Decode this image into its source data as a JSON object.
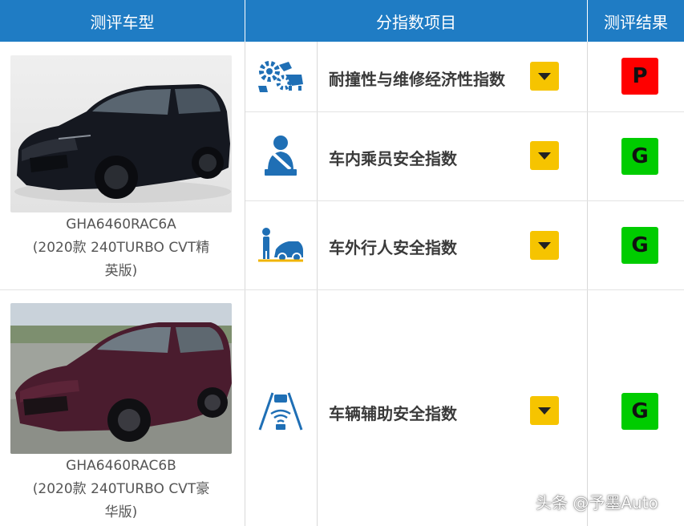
{
  "header": {
    "col_model": "测评车型",
    "col_items": "分指数项目",
    "col_result": "测评结果"
  },
  "colors": {
    "header_bg": "#1f7cc4",
    "dropdown": "#f6c400",
    "rating_poor": "#ff0000",
    "rating_good": "#00cc00",
    "icon_blue": "#1f6fb5"
  },
  "cars": [
    {
      "model_code": "GHA6460RAC6A",
      "variant_line1": "(2020款 240TURBO CVT精",
      "variant_line2": "英版)",
      "photo": "black-suv-photo"
    },
    {
      "model_code": "GHA6460RAC6B",
      "variant_line1": "(2020款 240TURBO CVT豪",
      "variant_line2": "华版)",
      "photo": "maroon-suv-photo"
    }
  ],
  "items": [
    {
      "icon": "crash-repair-icon",
      "label": "耐撞性与维修经济性指数",
      "rating": "P"
    },
    {
      "icon": "occupant-seatbelt-icon",
      "label": "车内乘员安全指数",
      "rating": "G"
    },
    {
      "icon": "pedestrian-car-icon",
      "label": "车外行人安全指数",
      "rating": "G"
    },
    {
      "icon": "driver-assist-icon",
      "label": "车辆辅助安全指数",
      "rating": "G"
    }
  ],
  "watermark": "头条 @予墨Auto"
}
